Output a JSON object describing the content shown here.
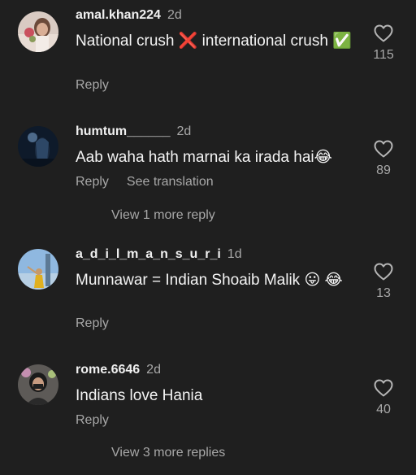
{
  "comments": [
    {
      "username": "amal.khan224",
      "time": "2d",
      "text": "National crush ❌ international crush ✅",
      "reply_label": "Reply",
      "likes": "115"
    },
    {
      "username": "humtum______",
      "time": "2d",
      "text": "Aab waha hath marnai ka irada hai😂",
      "reply_label": "Reply",
      "translate_label": "See translation",
      "likes": "89",
      "more_replies": "View 1 more reply"
    },
    {
      "username": "a_d_i_l_m_a_n_s_u_r_i",
      "time": "1d",
      "text": "Munnawar = Indian Shoaib Malik 😛 😂",
      "reply_label": "Reply",
      "likes": "13"
    },
    {
      "username": "rome.6646",
      "time": "2d",
      "text": "Indians love Hania",
      "reply_label": "Reply",
      "likes": "40",
      "more_replies": "View 3 more replies"
    }
  ],
  "icons": {
    "like": "heart-outline-icon"
  },
  "colors": {
    "background": "#1f1f1f",
    "secondary_text": "#a8a8a8"
  }
}
